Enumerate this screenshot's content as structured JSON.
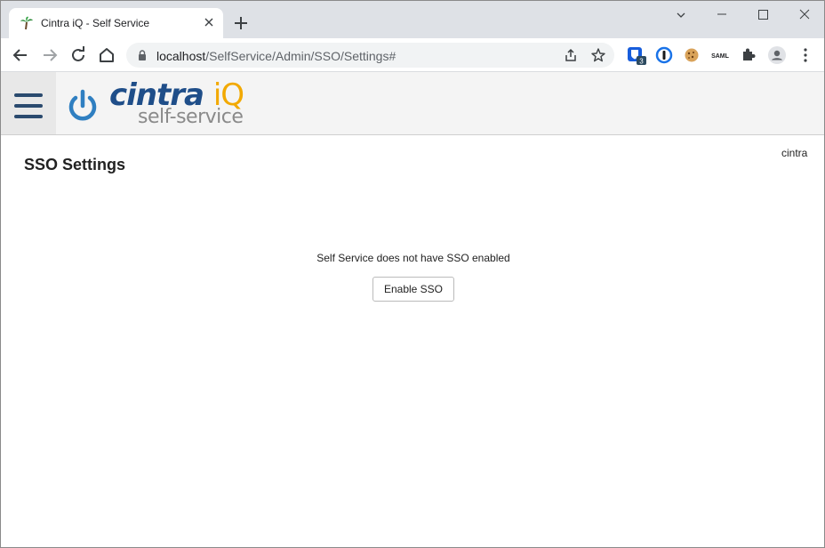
{
  "browser": {
    "tab_title": "Cintra iQ - Self Service",
    "url_host": "localhost",
    "url_path": "/SelfService/Admin/SSO/Settings#",
    "extension_badge": "3",
    "saml_label": "SAML"
  },
  "app": {
    "logo_main": "cintra",
    "logo_iq": "iQ",
    "logo_sub": "self-service",
    "brand_color": "#1f4e89",
    "accent_color": "#f2a900"
  },
  "page": {
    "title": "SSO Settings",
    "user": "cintra",
    "message": "Self Service does not have SSO enabled",
    "enable_button": "Enable SSO"
  }
}
